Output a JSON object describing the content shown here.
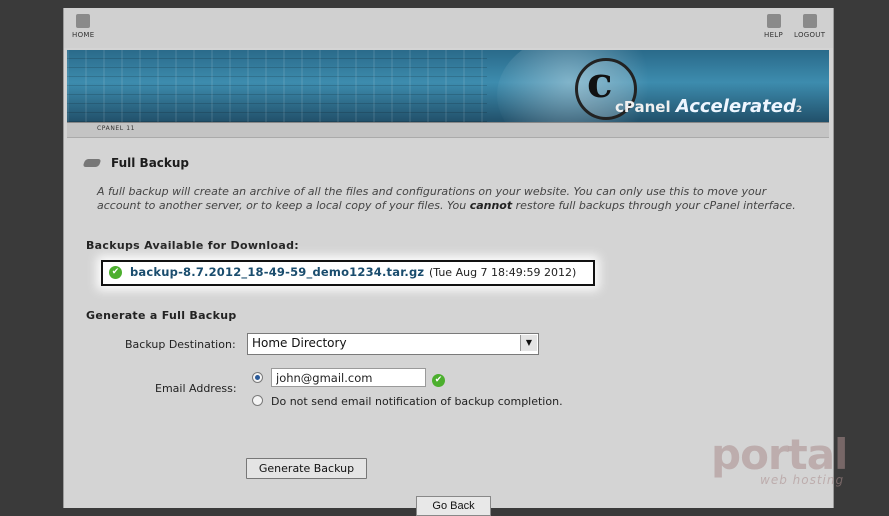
{
  "topbar": {
    "home": "HOME",
    "help": "HELP",
    "logout": "LOGOUT"
  },
  "banner": {
    "brand": "cPanel",
    "accel": "Accelerated",
    "version": "2"
  },
  "version_bar": "CPANEL 11",
  "page": {
    "title": "Full Backup",
    "desc_1": "A full backup will create an archive of all the files and configurations on your website. You can only use this to move your account to another server, or to keep a local copy of your files. You ",
    "desc_bold": "cannot",
    "desc_2": " restore full backups through your cPanel interface."
  },
  "available": {
    "heading": "Backups Available for Download:",
    "file": "backup-8.7.2012_18-49-59_demo1234.tar.gz",
    "date": "(Tue Aug 7 18:49:59 2012)"
  },
  "generate": {
    "heading": "Generate a Full Backup",
    "dest_label": "Backup Destination:",
    "dest_value": "Home Directory",
    "email_label": "Email Address:",
    "email_value": "john@gmail.com",
    "no_email_label": "Do not send email notification of backup completion.",
    "button": "Generate Backup",
    "go_button": "Go Back"
  },
  "watermark": {
    "main": "portal",
    "sub": "web hosting"
  }
}
